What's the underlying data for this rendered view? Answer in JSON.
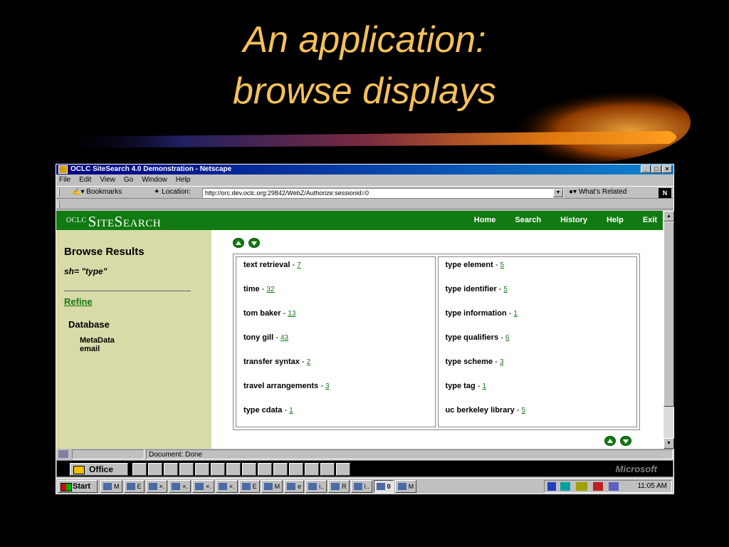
{
  "slide": {
    "title_line1": "An application:",
    "title_line2": "browse displays"
  },
  "window": {
    "title": "OCLC SiteSearch 4.0 Demonstration - Netscape",
    "controls": [
      "_",
      "□",
      "×"
    ]
  },
  "menu": [
    "File",
    "Edit",
    "View",
    "Go",
    "Window",
    "Help"
  ],
  "toolbar": {
    "bookmarks": "Bookmarks",
    "location_label": "Location:",
    "url": "http://orc.dev.oclc.org:29842/WebZ/Authorize:sessionid=0",
    "whats_related": "What's Related",
    "netscape_logo": "N"
  },
  "site": {
    "brand_prefix": "OCLC",
    "brand_name": "SiteSearch",
    "nav": [
      "Home",
      "Search",
      "History",
      "Help",
      "Exit"
    ]
  },
  "sidebar": {
    "heading": "Browse Results",
    "query": "sh= \"type\"",
    "refine": "Refine",
    "database_heading": "Database",
    "database_items": [
      "MetaData",
      "email"
    ]
  },
  "results": {
    "left": [
      {
        "term": "text retrieval",
        "count": "7"
      },
      {
        "term": "time",
        "count": "32"
      },
      {
        "term": "tom baker",
        "count": "13"
      },
      {
        "term": "tony gill",
        "count": "43"
      },
      {
        "term": "transfer syntax",
        "count": "2"
      },
      {
        "term": "travel arrangements",
        "count": "3"
      },
      {
        "term": "type cdata",
        "count": "1"
      }
    ],
    "right": [
      {
        "term": "type element",
        "count": "5"
      },
      {
        "term": "type identifier",
        "count": "5"
      },
      {
        "term": "type information",
        "count": "1"
      },
      {
        "term": "type qualifiers",
        "count": "6"
      },
      {
        "term": "type scheme",
        "count": "3"
      },
      {
        "term": "type tag",
        "count": "1"
      },
      {
        "term": "uc berkeley library",
        "count": "5"
      }
    ],
    "separator": "-"
  },
  "status": {
    "document": "Document: Done"
  },
  "office_bar": {
    "label": "Office",
    "brand": "Microsoft"
  },
  "taskbar": {
    "start": "Start",
    "tasks": [
      "M",
      "E",
      "×.",
      "×.",
      "×.",
      "×.",
      "E",
      "M",
      "e",
      "i..",
      "R",
      "l..",
      "0",
      "M"
    ],
    "clock": "11:05 AM"
  },
  "colors": {
    "title": "#f5c05a",
    "banner_green": "#127a12",
    "sidebar_bg": "#d8daa8",
    "titlebar_blue": "#000080"
  }
}
